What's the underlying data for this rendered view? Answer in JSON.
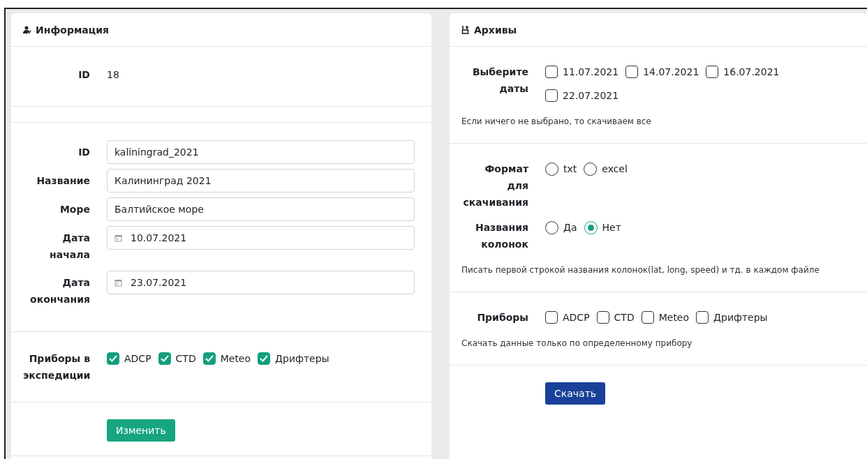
{
  "info_card": {
    "title": "Информация",
    "summary": {
      "label": "ID",
      "value": "18"
    },
    "fields": [
      {
        "label": "ID",
        "value": "kaliningrad_2021",
        "kind": "text"
      },
      {
        "label": "Название",
        "value": "Калининград 2021",
        "kind": "text"
      },
      {
        "label": "Море",
        "value": "Балтийское море",
        "kind": "text"
      },
      {
        "label": "Дата начала",
        "value": "10.07.2021",
        "kind": "date"
      },
      {
        "label": "Дата окончания",
        "value": "23.07.2021",
        "kind": "date"
      }
    ],
    "instruments": {
      "label": "Приборы в экспедиции",
      "options": [
        {
          "label": "ADCP",
          "checked": true
        },
        {
          "label": "CTD",
          "checked": true
        },
        {
          "label": "Meteo",
          "checked": true
        },
        {
          "label": "Дрифтеры",
          "checked": true
        }
      ]
    },
    "button": "Изменить"
  },
  "archive_card": {
    "title": "Архивы",
    "dates": {
      "label": "Выберите даты",
      "options": [
        {
          "label": "11.07.2021",
          "checked": false
        },
        {
          "label": "14.07.2021",
          "checked": false
        },
        {
          "label": "16.07.2021",
          "checked": false
        },
        {
          "label": "22.07.2021",
          "checked": false
        }
      ],
      "hint": "Если ничего не выбрано, то скачиваем все"
    },
    "format": {
      "label": "Формат для скачивания",
      "options": [
        {
          "label": "txt",
          "selected": false
        },
        {
          "label": "excel",
          "selected": false
        }
      ]
    },
    "column_names": {
      "label": "Названия колонок",
      "options": [
        {
          "label": "Да",
          "selected": false
        },
        {
          "label": "Нет",
          "selected": true
        }
      ],
      "hint": "Писать первой строкой названия колонок(lat, long, speed) и тд. в каждом файле"
    },
    "instruments": {
      "label": "Приборы",
      "options": [
        {
          "label": "ADCP",
          "checked": false
        },
        {
          "label": "CTD",
          "checked": false
        },
        {
          "label": "Meteo",
          "checked": false
        },
        {
          "label": "Дрифтеры",
          "checked": false
        }
      ],
      "hint": "Скачать данные только по определенному прибору"
    },
    "button": "Скачать"
  }
}
